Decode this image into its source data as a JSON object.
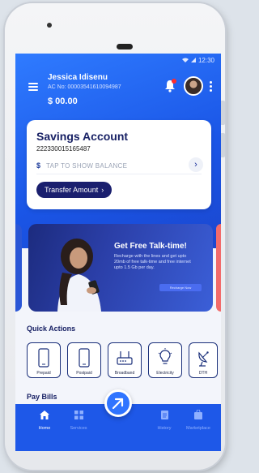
{
  "status_bar": {
    "time": "12:30"
  },
  "user": {
    "name": "Jessica Idisenu",
    "account_line": "AC No: 00003541610094987",
    "balance": "$ 00.00"
  },
  "savings_card": {
    "title": "Savings Account",
    "number": "222330015165487",
    "currency_symbol": "$",
    "tap_text": "TAP TO SHOW BALANCE",
    "transfer_label": "Transfer Amount"
  },
  "banner": {
    "title": "Get Free Talk-time!",
    "text": "Recharge with the lines and get upto 20mb of free talk-time and free internet upto 1.5 Gb per day.",
    "button_label": "Recharge Now"
  },
  "quick_actions": {
    "title": "Quick Actions",
    "items": [
      {
        "label": "Prepaid",
        "icon": "phone-icon"
      },
      {
        "label": "Postpaid",
        "icon": "phone-icon"
      },
      {
        "label": "Broadband",
        "icon": "router-icon"
      },
      {
        "label": "Electricity",
        "icon": "bulb-icon"
      },
      {
        "label": "DTH",
        "icon": "satellite-dish-icon"
      }
    ]
  },
  "pay_bills": {
    "title": "Pay Bills"
  },
  "bottom_nav": {
    "items": [
      {
        "label": "Home",
        "icon": "home-icon",
        "active": true
      },
      {
        "label": "Services",
        "icon": "grid-icon",
        "active": false
      },
      {
        "label": "History",
        "icon": "document-icon",
        "active": false
      },
      {
        "label": "Marketplace",
        "icon": "shopping-bag-icon",
        "active": false
      }
    ]
  },
  "colors": {
    "primary": "#1e58e8",
    "dark_navy": "#1a1f6e",
    "alert": "#ff2d2d"
  }
}
